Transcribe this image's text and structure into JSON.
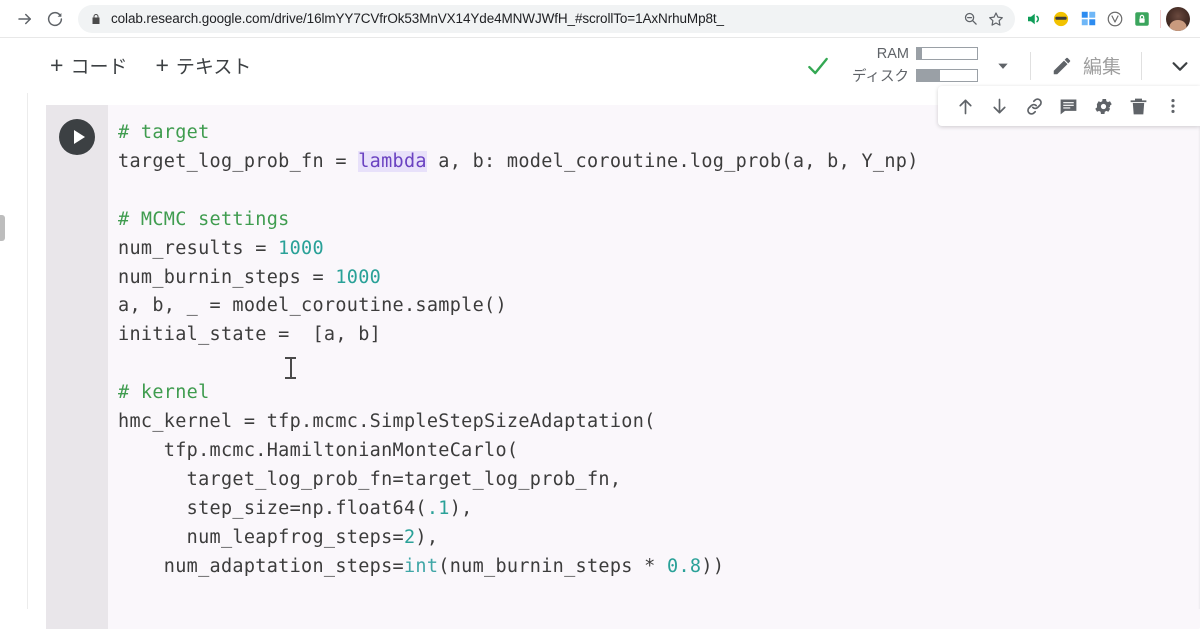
{
  "browser": {
    "url": "colab.research.google.com/drive/16lmYY7CVfrOk53MnVX14Yde4MNWJWfH_#scrollTo=1AxNrhuMp8t_",
    "nav": {
      "forward_icon": "forward-arrow-icon",
      "reload_icon": "reload-icon",
      "lock_icon": "lock-icon"
    },
    "omnibox_actions": [
      {
        "icon": "zoom-search-icon"
      },
      {
        "icon": "bookmark-star-icon"
      }
    ],
    "extensions": [
      {
        "icon": "audio-speaker-icon",
        "color": "#0f9d58"
      },
      {
        "icon": "emoji-sunglasses-icon",
        "color": "#f2b705"
      },
      {
        "icon": "windows-grid-icon",
        "color": "#2d8cf0"
      },
      {
        "icon": "v-circle-icon",
        "color": "#6b6b6b"
      },
      {
        "icon": "green-lock-shield-icon",
        "color": "#3ba55d"
      }
    ],
    "avatar": "user-avatar"
  },
  "toolbar": {
    "add_code_label": "コード",
    "add_text_label": "テキスト",
    "plus_symbol": "+",
    "connection_status_icon": "green-check-icon",
    "ram_label": "RAM",
    "disk_label": "ディスク",
    "ram_fill_percent": 8,
    "disk_fill_percent": 38,
    "dropdown_icon": "caret-down-icon",
    "edit_label": "編集",
    "edit_icon": "pencil-icon",
    "end_chevron_icon": "chevron-down-icon"
  },
  "cell_toolbar": {
    "buttons": [
      {
        "name": "move-cell-up-button",
        "icon": "arrow-up-icon"
      },
      {
        "name": "move-cell-down-button",
        "icon": "arrow-down-icon"
      },
      {
        "name": "copy-cell-link-button",
        "icon": "link-icon"
      },
      {
        "name": "add-comment-button",
        "icon": "comment-icon"
      },
      {
        "name": "cell-settings-button",
        "icon": "gear-icon"
      },
      {
        "name": "delete-cell-button",
        "icon": "trash-icon"
      },
      {
        "name": "more-options-button",
        "icon": "vertical-dots-icon"
      }
    ]
  },
  "cell": {
    "run_button_icon": "play-icon",
    "code_lines": [
      {
        "segments": [
          {
            "t": "# target",
            "c": "tok-comment"
          }
        ]
      },
      {
        "segments": [
          {
            "t": "target_log_prob_fn = ",
            "c": ""
          },
          {
            "t": "lambda",
            "c": "tok-kw"
          },
          {
            "t": " a, b: model_coroutine.log_prob(a, b, Y_np)",
            "c": ""
          }
        ]
      },
      {
        "segments": [
          {
            "t": "",
            "c": ""
          }
        ]
      },
      {
        "segments": [
          {
            "t": "# MCMC settings",
            "c": "tok-comment"
          }
        ]
      },
      {
        "segments": [
          {
            "t": "num_results = ",
            "c": ""
          },
          {
            "t": "1000",
            "c": "tok-num"
          }
        ]
      },
      {
        "segments": [
          {
            "t": "num_burnin_steps = ",
            "c": ""
          },
          {
            "t": "1000",
            "c": "tok-num"
          }
        ]
      },
      {
        "segments": [
          {
            "t": "a, b, _ = model_coroutine.sample()",
            "c": ""
          }
        ]
      },
      {
        "segments": [
          {
            "t": "initial_state =  [a, b]",
            "c": ""
          }
        ]
      },
      {
        "segments": [
          {
            "t": "",
            "c": ""
          }
        ]
      },
      {
        "segments": [
          {
            "t": "# kernel",
            "c": "tok-comment"
          }
        ]
      },
      {
        "segments": [
          {
            "t": "hmc_kernel = tfp.mcmc.SimpleStepSizeAdaptation(",
            "c": ""
          }
        ]
      },
      {
        "segments": [
          {
            "t": "    tfp.mcmc.HamiltonianMonteCarlo(",
            "c": ""
          }
        ]
      },
      {
        "segments": [
          {
            "t": "      target_log_prob_fn=target_log_prob_fn,",
            "c": ""
          }
        ]
      },
      {
        "segments": [
          {
            "t": "      step_size=np.float64(",
            "c": ""
          },
          {
            "t": ".1",
            "c": "tok-num"
          },
          {
            "t": "),",
            "c": ""
          }
        ]
      },
      {
        "segments": [
          {
            "t": "      num_leapfrog_steps=",
            "c": ""
          },
          {
            "t": "2",
            "c": "tok-num"
          },
          {
            "t": "),",
            "c": ""
          }
        ]
      },
      {
        "segments": [
          {
            "t": "    num_adaptation_steps=",
            "c": ""
          },
          {
            "t": "int",
            "c": "tok-builtin"
          },
          {
            "t": "(num_burnin_steps * ",
            "c": ""
          },
          {
            "t": "0.8",
            "c": "tok-num"
          },
          {
            "t": "))",
            "c": ""
          }
        ]
      }
    ],
    "text_cursor": "i-beam-cursor"
  }
}
